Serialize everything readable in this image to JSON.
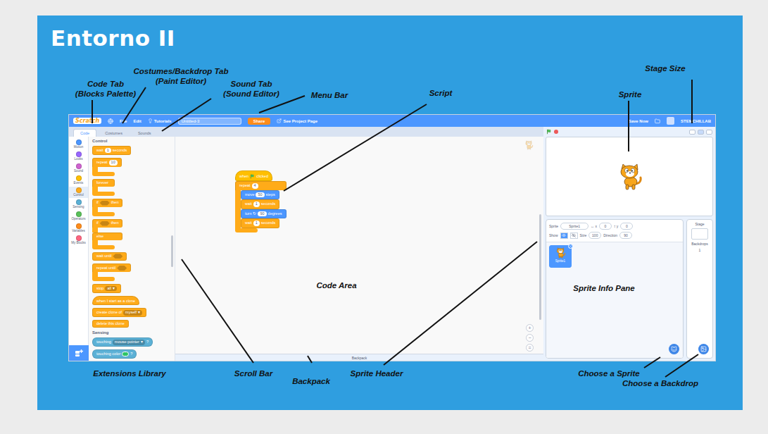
{
  "slide": {
    "title": "Entorno II"
  },
  "annotations": [
    {
      "lines": [
        "Code Tab",
        "(Blocks Palette)"
      ]
    },
    {
      "lines": [
        "Costumes/Backdrop Tab",
        "(Paint Editor)"
      ]
    },
    {
      "lines": [
        "Sound Tab",
        "(Sound Editor)"
      ]
    },
    {
      "lines": [
        "Menu Bar"
      ]
    },
    {
      "lines": [
        "Script"
      ]
    },
    {
      "lines": [
        "Stage Size"
      ]
    },
    {
      "lines": [
        "Sprite"
      ]
    },
    {
      "lines": [
        "Code Area"
      ]
    },
    {
      "lines": [
        "Sprite Info Pane"
      ]
    },
    {
      "lines": [
        "Extensions Library"
      ]
    },
    {
      "lines": [
        "Scroll Bar"
      ]
    },
    {
      "lines": [
        "Backpack"
      ]
    },
    {
      "lines": [
        "Sprite Header"
      ]
    },
    {
      "lines": [
        "Choose a Sprite"
      ]
    },
    {
      "lines": [
        "Choose a Backdrop"
      ]
    }
  ],
  "editor": {
    "menu_bar": {
      "logo": "Scratch",
      "items": [
        "File",
        "Edit"
      ],
      "tutorials": "Tutorials",
      "project_title": "Untitled-3",
      "share": "Share",
      "see_project_page": "See Project Page",
      "save_now": "Save Now",
      "user": "STEMCHILLAB"
    },
    "tabs": [
      {
        "label": "Code",
        "selected": true
      },
      {
        "label": "Costumes",
        "selected": false
      },
      {
        "label": "Sounds",
        "selected": false
      }
    ],
    "categories": [
      {
        "label": "Motion",
        "color": "#4c97ff",
        "selected": false
      },
      {
        "label": "Looks",
        "color": "#9966ff",
        "selected": false
      },
      {
        "label": "Sound",
        "color": "#cf63cf",
        "selected": false
      },
      {
        "label": "Events",
        "color": "#ffbf00",
        "selected": false
      },
      {
        "label": "Control",
        "color": "#ffab19",
        "selected": true
      },
      {
        "label": "Sensing",
        "color": "#5cb1d6",
        "selected": false
      },
      {
        "label": "Operators",
        "color": "#59c059",
        "selected": false
      },
      {
        "label": "Variables",
        "color": "#ff8c1a",
        "selected": false
      },
      {
        "label": "My Blocks",
        "color": "#ff6680",
        "selected": false
      }
    ],
    "palette": [
      {
        "title": "Control",
        "blocks": [
          {
            "kind": "stack",
            "color": "#ffab19",
            "parts": [
              {
                "kind": "text",
                "value": "wait"
              },
              {
                "kind": "input",
                "value": "1"
              },
              {
                "kind": "text",
                "value": "seconds"
              }
            ]
          },
          {
            "kind": "c",
            "color": "#ffab19",
            "parts": [
              {
                "kind": "text",
                "value": "repeat"
              },
              {
                "kind": "input",
                "value": "10"
              }
            ],
            "children": []
          },
          {
            "kind": "c",
            "color": "#ffab19",
            "parts": [
              {
                "kind": "text",
                "value": "forever"
              }
            ],
            "children": []
          },
          {
            "kind": "c",
            "color": "#ffab19",
            "parts": [
              {
                "kind": "text",
                "value": "if"
              },
              {
                "kind": "slot"
              },
              {
                "kind": "text",
                "value": "then"
              }
            ],
            "children": []
          },
          {
            "kind": "e",
            "color": "#ffab19",
            "parts": [
              {
                "kind": "text",
                "value": "if"
              },
              {
                "kind": "slot"
              },
              {
                "kind": "text",
                "value": "then"
              }
            ],
            "middle": [
              {
                "kind": "text",
                "value": "else"
              }
            ],
            "children": []
          },
          {
            "kind": "stack",
            "color": "#ffab19",
            "parts": [
              {
                "kind": "text",
                "value": "wait until"
              },
              {
                "kind": "slot"
              }
            ]
          },
          {
            "kind": "c",
            "color": "#ffab19",
            "parts": [
              {
                "kind": "text",
                "value": "repeat until"
              },
              {
                "kind": "slot"
              }
            ],
            "children": []
          },
          {
            "kind": "cap",
            "color": "#ffab19",
            "parts": [
              {
                "kind": "text",
                "value": "stop"
              },
              {
                "kind": "menu",
                "value": "all",
                "arrow": "▾"
              }
            ]
          },
          {
            "kind": "hat",
            "color": "#ffab19",
            "parts": [
              {
                "kind": "text",
                "value": "when I start as a clone"
              }
            ]
          },
          {
            "kind": "stack",
            "color": "#ffab19",
            "parts": [
              {
                "kind": "text",
                "value": "create clone of"
              },
              {
                "kind": "menu",
                "value": "myself",
                "arrow": "▾"
              }
            ]
          },
          {
            "kind": "cap",
            "color": "#ffab19",
            "parts": [
              {
                "kind": "text",
                "value": "delete this clone"
              }
            ]
          }
        ]
      },
      {
        "title": "Sensing",
        "blocks": [
          {
            "kind": "boolean",
            "color": "#5cb1d6",
            "parts": [
              {
                "kind": "text",
                "value": "touching"
              },
              {
                "kind": "menu",
                "value": "mouse-pointer",
                "arrow": "▾"
              },
              {
                "kind": "text",
                "value": "?"
              }
            ]
          },
          {
            "kind": "boolean",
            "color": "#5cb1d6",
            "parts": [
              {
                "kind": "text",
                "value": "touching color"
              },
              {
                "kind": "color",
                "value": "#2ec466"
              },
              {
                "kind": "text",
                "value": "?"
              }
            ]
          }
        ]
      }
    ],
    "script": [
      {
        "kind": "hat",
        "color": "#ffbf00",
        "parts": [
          {
            "kind": "text",
            "value": "when"
          },
          {
            "kind": "flag"
          },
          {
            "kind": "text",
            "value": "clicked"
          }
        ]
      },
      {
        "kind": "c",
        "color": "#ffab19",
        "parts": [
          {
            "kind": "text",
            "value": "repeat"
          },
          {
            "kind": "input",
            "value": "4"
          }
        ],
        "children": [
          {
            "kind": "stack",
            "color": "#4c97ff",
            "parts": [
              {
                "kind": "text",
                "value": "move"
              },
              {
                "kind": "input",
                "value": "50"
              },
              {
                "kind": "text",
                "value": "steps"
              }
            ]
          },
          {
            "kind": "stack",
            "color": "#ffab19",
            "parts": [
              {
                "kind": "text",
                "value": "wait"
              },
              {
                "kind": "input",
                "value": "1"
              },
              {
                "kind": "text",
                "value": "seconds"
              }
            ]
          },
          {
            "kind": "stack",
            "color": "#4c97ff",
            "parts": [
              {
                "kind": "text",
                "value": "turn"
              },
              {
                "kind": "text",
                "value": "↻"
              },
              {
                "kind": "input",
                "value": "90"
              },
              {
                "kind": "text",
                "value": "degrees"
              }
            ]
          },
          {
            "kind": "stack",
            "color": "#ffab19",
            "parts": [
              {
                "kind": "text",
                "value": "wait"
              },
              {
                "kind": "input",
                "value": "1"
              },
              {
                "kind": "text",
                "value": "seconds"
              }
            ]
          }
        ]
      }
    ],
    "zoom": [
      "+",
      "−",
      "="
    ],
    "backpack": "Backpack",
    "sprite_info": {
      "sprite_label": "Sprite",
      "sprite_name": "Sprite1",
      "x_label": "↔ x",
      "x": "0",
      "y_label": "↕ y",
      "y": "0",
      "show_label": "Show",
      "show": true,
      "size_label": "Size",
      "size": "100",
      "direction_label": "Direction",
      "direction": "90"
    },
    "sprites": [
      {
        "name": "Sprite1",
        "selected": true
      }
    ],
    "stage_pane": {
      "title": "Stage",
      "backdrops_label": "Backdrops",
      "backdrops": "1"
    }
  }
}
